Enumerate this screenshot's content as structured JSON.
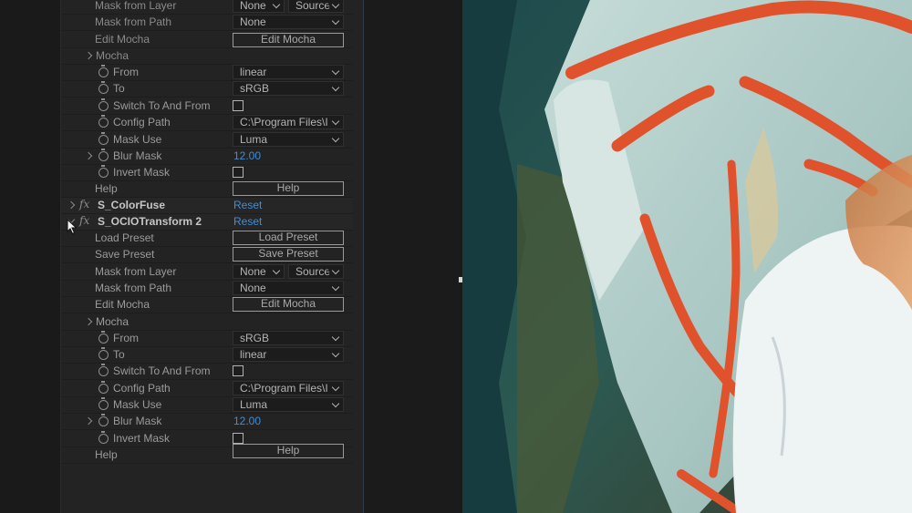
{
  "panel": {
    "top_rows": {
      "mask_from_layer": {
        "label": "Mask from Layer",
        "value": "None",
        "value2": "Source"
      },
      "mask_from_path": {
        "label": "Mask from Path",
        "value": "None"
      },
      "edit_mocha": {
        "label": "Edit Mocha",
        "button": "Edit Mocha"
      },
      "mocha": {
        "label": "Mocha"
      },
      "from": {
        "label": "From",
        "value": "linear"
      },
      "to": {
        "label": "To",
        "value": "sRGB"
      },
      "switch": {
        "label": "Switch To And From"
      },
      "config_path": {
        "label": "Config Path",
        "value": "C:\\Program Files\\I"
      },
      "mask_use": {
        "label": "Mask Use",
        "value": "Luma"
      },
      "blur_mask": {
        "label": "Blur Mask",
        "value": "12.00"
      },
      "invert_mask": {
        "label": "Invert Mask"
      },
      "help": {
        "label": "Help",
        "button": "Help"
      }
    },
    "colorfuse": {
      "name": "S_ColorFuse",
      "reset": "Reset"
    },
    "ocio2": {
      "name": "S_OCIOTransform 2",
      "reset": "Reset",
      "load_preset": {
        "label": "Load Preset",
        "button": "Load Preset"
      },
      "save_preset": {
        "label": "Save Preset",
        "button": "Save Preset"
      },
      "mask_from_layer": {
        "label": "Mask from Layer",
        "value": "None",
        "value2": "Source"
      },
      "mask_from_path": {
        "label": "Mask from Path",
        "value": "None"
      },
      "edit_mocha": {
        "label": "Edit Mocha",
        "button": "Edit Mocha"
      },
      "mocha": {
        "label": "Mocha"
      },
      "from": {
        "label": "From",
        "value": "sRGB"
      },
      "to": {
        "label": "To",
        "value": "linear"
      },
      "switch": {
        "label": "Switch To And From"
      },
      "config_path": {
        "label": "Config Path",
        "value": "C:\\Program Files\\I"
      },
      "mask_use": {
        "label": "Mask Use",
        "value": "Luma"
      },
      "blur_mask": {
        "label": "Blur Mask",
        "value": "12.00"
      },
      "invert_mask": {
        "label": "Invert Mask"
      },
      "help": {
        "label": "Help",
        "button": "Help"
      }
    }
  },
  "colors": {
    "panel_bg": "#232323",
    "link_blue": "#3e8ed8",
    "graffiti_orange": "#e0522c",
    "wall_teal": "#a9c9c6"
  },
  "icons": [
    "stopwatch-icon",
    "fx-icon",
    "chevron-right-icon",
    "chevron-down-icon",
    "mouse-pointer-icon"
  ]
}
